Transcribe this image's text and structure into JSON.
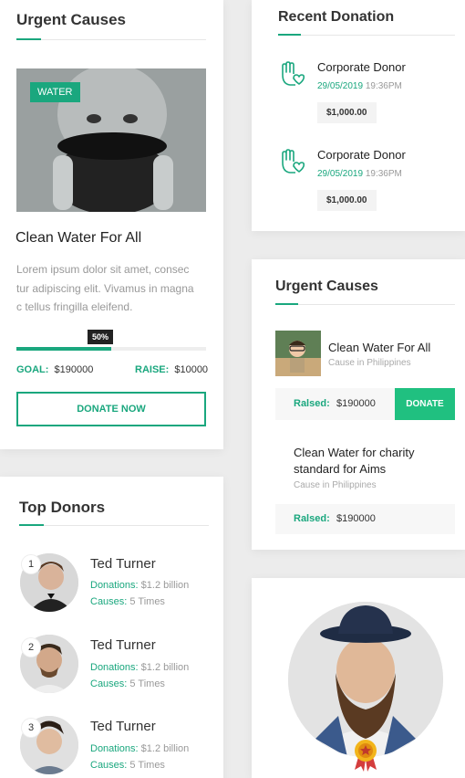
{
  "urgent_left": {
    "title": "Urgent Causes",
    "tag": "WATER",
    "cause_title": "Clean Water For All",
    "desc_line1": "Lorem ipsum dolor sit amet, consec",
    "desc_line2": "tur adipiscing elit. Vivamus in magna",
    "desc_line3": "c tellus fringilla eleifend.",
    "progress": 0.5,
    "progress_label": "50%",
    "goal_label": "GOAL:",
    "goal_value": "$190000",
    "raise_label": "RAISE:",
    "raise_value": "$10000",
    "donate_label": "DONATE NOW"
  },
  "top_donors": {
    "title": "Top Donors",
    "donors": [
      {
        "rank": "1",
        "name": "Ted Turner",
        "donations_label": "Donations:",
        "donations_value": "$1.2 billion",
        "causes_label": "Causes:",
        "causes_value": "5 Times"
      },
      {
        "rank": "2",
        "name": "Ted Turner",
        "donations_label": "Donations:",
        "donations_value": "$1.2 billion",
        "causes_label": "Causes:",
        "causes_value": "5 Times"
      },
      {
        "rank": "3",
        "name": "Ted Turner",
        "donations_label": "Donations:",
        "donations_value": "$1.2 billion",
        "causes_label": "Causes:",
        "causes_value": "5 Times"
      }
    ]
  },
  "recent": {
    "title": "Recent Donation",
    "items": [
      {
        "name": "Corporate Donor",
        "date": "29/05/2019",
        "time": "19:36PM",
        "amount": "$1,000.00"
      },
      {
        "name": "Corporate Donor",
        "date": "29/05/2019",
        "time": "19:36PM",
        "amount": "$1,000.00"
      }
    ]
  },
  "urgent_right": {
    "title": "Urgent Causes",
    "item1": {
      "name": "Clean Water For All",
      "location": "Cause in Philippines",
      "raised_label": "Ralsed:",
      "raised_value": "$190000",
      "donate_label": "DONATE"
    },
    "item2": {
      "name_line1": "Clean Water for charity",
      "name_line2": "standard for Aims",
      "location": "Cause in Philippines",
      "raised_label": "Ralsed:",
      "raised_value": "$190000"
    }
  },
  "colors": {
    "accent": "#1aa77e",
    "donate": "#20c080"
  },
  "icons": [
    "heart-hand-icon",
    "badge-icon"
  ]
}
